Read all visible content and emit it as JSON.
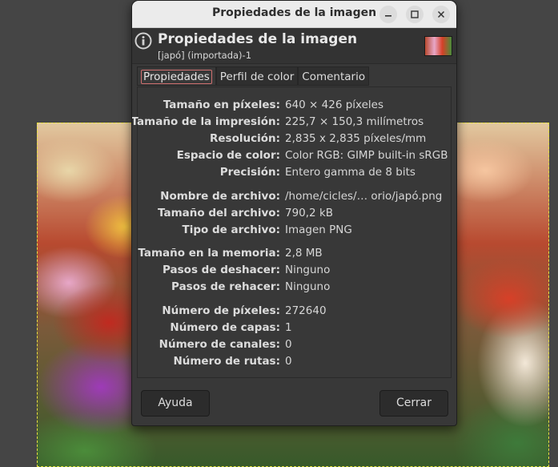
{
  "window": {
    "title": "Propiedades de la imagen"
  },
  "header": {
    "title": "Propiedades de la imagen",
    "subtitle": "[japó] (importada)-1"
  },
  "tabs": [
    {
      "label": "Propiedades"
    },
    {
      "label": "Perfil de color"
    },
    {
      "label": "Comentario"
    }
  ],
  "properties": [
    {
      "label": "Tamaño en píxeles:",
      "value": "640 × 426 píxeles"
    },
    {
      "label": "Tamaño de la impresión:",
      "value": "225,7 × 150,3 milímetros"
    },
    {
      "label": "Resolución:",
      "value": "2,835 x 2,835 píxeles/mm"
    },
    {
      "label": "Espacio de color:",
      "value": "Color RGB: GIMP built-in sRGB"
    },
    {
      "label": "Precisión:",
      "value": "Entero gamma de 8 bits"
    },
    {
      "label": "Nombre de archivo:",
      "value": "/home/cicles/…  orio/japó.png"
    },
    {
      "label": "Tamaño del archivo:",
      "value": "790,2 kB"
    },
    {
      "label": "Tipo de archivo:",
      "value": "Imagen PNG"
    },
    {
      "label": "Tamaño en la memoria:",
      "value": "2,8 MB"
    },
    {
      "label": "Pasos de deshacer:",
      "value": "Ninguno"
    },
    {
      "label": "Pasos de rehacer:",
      "value": "Ninguno"
    },
    {
      "label": "Número de píxeles:",
      "value": "272640"
    },
    {
      "label": "Número de capas:",
      "value": "1"
    },
    {
      "label": "Número de canales:",
      "value": "0"
    },
    {
      "label": "Número de rutas:",
      "value": "0"
    }
  ],
  "buttons": {
    "help": "Ayuda",
    "close": "Cerrar"
  },
  "icons": [
    "info-icon",
    "minimize-icon",
    "maximize-icon",
    "close-icon"
  ]
}
